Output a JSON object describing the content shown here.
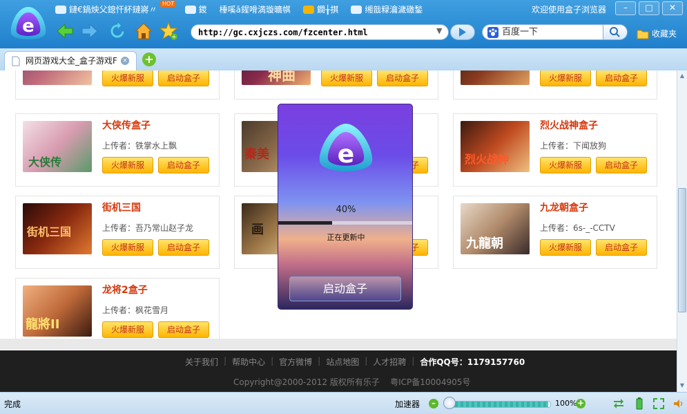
{
  "browser": {
    "favorites": [
      {
        "label": "鏈€鍋炴父鎴忓紑鏈嶈〃"
      },
      {
        "label": "鍐"
      },
      {
        "label": "棰嗘ā鍟嗗満璇曠帺"
      },
      {
        "label": "鐗╁掑"
      },
      {
        "label": "缃戠粶瀹濊礉鍫"
      }
    ],
    "hot_badge": "HOT",
    "welcome": "欢迎使用盒子浏览器",
    "window_buttons": {
      "minimize": "–",
      "maximize": "□",
      "close": "✕"
    },
    "url": "http://gc.cxjczs.com/fzcenter.html",
    "search_placeholder": "百度一下",
    "bookmark_label": "收藏夹",
    "tab_title": "网页游戏大全_盒子游戏F",
    "tab_close": "×",
    "tab_add": "+"
  },
  "colors": {
    "accent": "#1f7fcc",
    "game_title": "#d4380d",
    "button_yellow": "#ffc400",
    "footer_bg": "#1f1f1f"
  },
  "common": {
    "hot_server": "火爆新服",
    "launch_box": "启动盒子",
    "uploader_prefix": "上传者："
  },
  "games": [
    {
      "title": "大侠传盒子",
      "uploader": "上传者：铁掌水上飘"
    },
    {
      "title": "烈火战神盒子",
      "uploader": "上传者：下闻放狗"
    },
    {
      "title": "街机三国",
      "uploader": "上传者：吾乃常山赵子龙"
    },
    {
      "title": "九龙朝盒子",
      "uploader": "上传者：6s-_-CCTV"
    },
    {
      "title": "龙将2盒子",
      "uploader": "上传者：枫花雪月"
    }
  ],
  "thumb_text": {
    "shenqu": "神曲",
    "daxiazhuan": "大侠传",
    "qinmei": "秦美",
    "liehuo": "烈火战神",
    "jieji": "街机三国",
    "hua": "画",
    "jiulong": "九龍朝",
    "longjiang": "龍將II"
  },
  "footer": {
    "links": [
      "关于我们",
      "帮助中心",
      "官方微博",
      "站点地图",
      "人才招聘"
    ],
    "qq": "合作QQ号：1179157760",
    "copyright": "Copyright@2000-2012 版权所有乐子",
    "icp": "粤ICP备10004905号"
  },
  "popup": {
    "percent_text": "40%",
    "progress": 0.4,
    "status": "正在更新中",
    "launch": "启动盒子"
  },
  "statusbar": {
    "status": "完成",
    "accelerator": "加速器",
    "zoom": "100%",
    "zoom_level": 0.98
  }
}
